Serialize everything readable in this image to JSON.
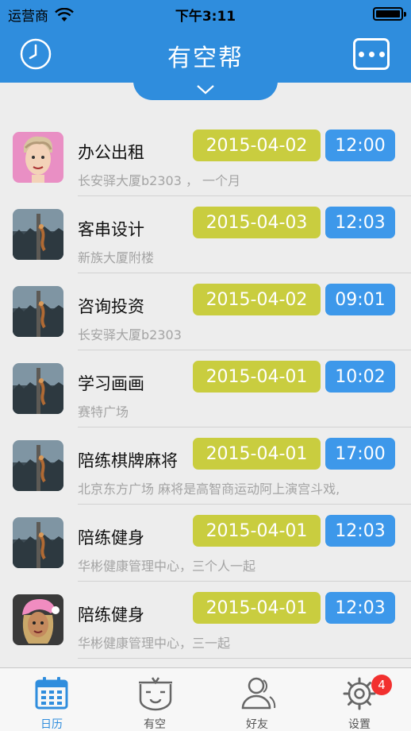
{
  "status_bar": {
    "carrier": "运营商",
    "time": "下午3:11"
  },
  "nav": {
    "title": "有空帮"
  },
  "items": [
    {
      "title": "办公出租",
      "subtitle": "长安驿大厦b2303 ， 一个月",
      "date": "2015-04-02",
      "time": "12:00",
      "avatar": "cartoon-man-avatar"
    },
    {
      "title": "客串设计",
      "subtitle": "新族大厦附楼",
      "date": "2015-04-03",
      "time": "12:03",
      "avatar": "climber-photo-avatar"
    },
    {
      "title": "咨询投资",
      "subtitle": "长安驿大厦b2303",
      "date": "2015-04-02",
      "time": "09:01",
      "avatar": "climber-photo-avatar"
    },
    {
      "title": "学习画画",
      "subtitle": "赛特广场",
      "date": "2015-04-01",
      "time": "10:02",
      "avatar": "climber-photo-avatar"
    },
    {
      "title": "陪练棋牌麻将",
      "subtitle": "北京东方广场 麻将是高智商运动阿上演宫斗戏,",
      "date": "2015-04-01",
      "time": "17:00",
      "avatar": "climber-photo-avatar"
    },
    {
      "title": "陪练健身",
      "subtitle": "华彬健康管理中心，三个人一起",
      "date": "2015-04-01",
      "time": "12:03",
      "avatar": "climber-photo-avatar"
    },
    {
      "title": "陪练健身",
      "subtitle": "华彬健康管理中心，三一起",
      "date": "2015-04-01",
      "time": "12:03",
      "avatar": "cartoon-woman-avatar"
    }
  ],
  "tabs": [
    {
      "label": "日历",
      "icon": "calendar-icon",
      "active": true
    },
    {
      "label": "有空",
      "icon": "free-face-icon",
      "active": false
    },
    {
      "label": "好友",
      "icon": "friends-icon",
      "active": false
    },
    {
      "label": "设置",
      "icon": "gear-icon",
      "active": false,
      "badge": "4"
    }
  ],
  "colors": {
    "primary": "#2f8ddd",
    "date_tag": "#c9cd3f",
    "time_tag": "#3d98ea",
    "badge": "#f2302f"
  }
}
